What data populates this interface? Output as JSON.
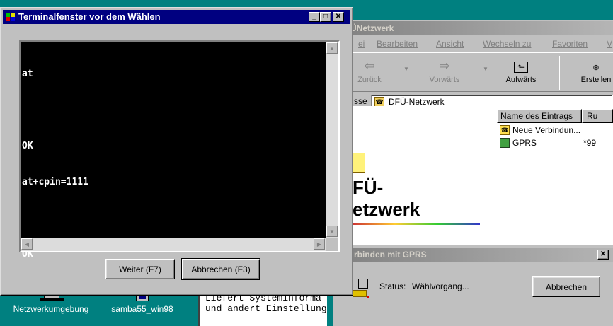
{
  "terminal": {
    "title": "Terminalfenster vor dem Wählen",
    "lines": [
      "at",
      "",
      "OK",
      "at+cpin=1111",
      "",
      "OK"
    ],
    "buttons": {
      "next": "Weiter (F7)",
      "cancel": "Abbrechen (F3)"
    }
  },
  "explorer": {
    "title": "DFÜ-Netzwerk",
    "title_visible": "ÜNetzwerk",
    "menu": [
      "ei",
      "Bearbeiten",
      "Ansicht",
      "Wechseln zu",
      "Favoriten",
      "V"
    ],
    "toolbar": {
      "back": "Zurück",
      "forward": "Vorwärts",
      "up": "Aufwärts",
      "create": "Erstellen"
    },
    "address_label": "sse",
    "address_value": "DFÜ-Netzwerk",
    "heading_line1": "FÜ-",
    "heading_line2": "etzwerk",
    "columns": {
      "name": "Name des Eintrags",
      "number": "Ru"
    },
    "items": [
      {
        "name": "Neue Verbindun...",
        "number": ""
      },
      {
        "name": "GPRS",
        "number": "*99"
      }
    ]
  },
  "dial": {
    "title": "rbinden mit GPRS",
    "status_label": "Status:",
    "status_value": "Wählvorgang...",
    "cancel": "Abbrechen"
  },
  "desktop": {
    "icons": [
      "Netzwerkumgebung",
      "samba55_win98"
    ],
    "info_line1": "Liefert Systeminforma",
    "info_line2": "und ändert Einstellung"
  }
}
